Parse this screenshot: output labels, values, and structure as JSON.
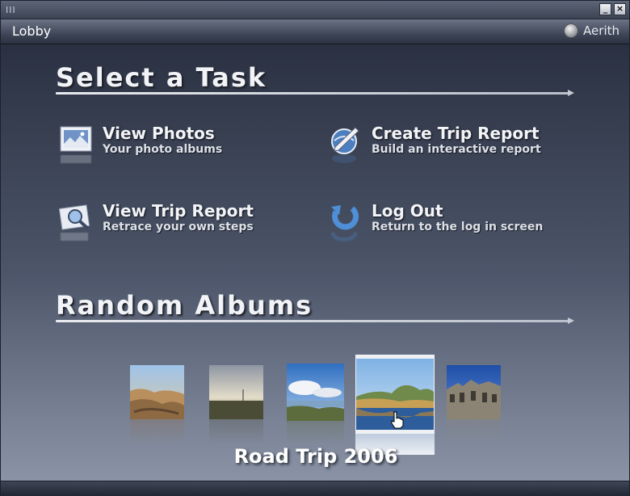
{
  "window": {
    "grip": "III",
    "minimize_label": "_",
    "close_label": "×"
  },
  "header": {
    "title": "Lobby",
    "user_name": "Aerith"
  },
  "tasks_section": {
    "heading": "Select a Task",
    "tasks": [
      {
        "title": "View Photos",
        "subtitle": "Your photo albums",
        "icon": "photos-icon"
      },
      {
        "title": "Create Trip Report",
        "subtitle": "Build an interactive report",
        "icon": "create-report-icon"
      },
      {
        "title": "View Trip Report",
        "subtitle": "Retrace your own steps",
        "icon": "view-report-icon"
      },
      {
        "title": "Log Out",
        "subtitle": "Return to the log in screen",
        "icon": "logout-icon"
      }
    ]
  },
  "albums_section": {
    "heading": "Random Albums",
    "selected_caption": "Road Trip 2006",
    "thumbnails": [
      {
        "name": "desert-badlands"
      },
      {
        "name": "sunset-field"
      },
      {
        "name": "lake-clouds"
      },
      {
        "name": "mountain-lake"
      },
      {
        "name": "historic-building"
      }
    ]
  },
  "colors": {
    "title_text": "#f3f4f7",
    "subtitle_text": "#dde1e8",
    "background_top": "#232838",
    "background_bottom": "#8e97a8"
  }
}
